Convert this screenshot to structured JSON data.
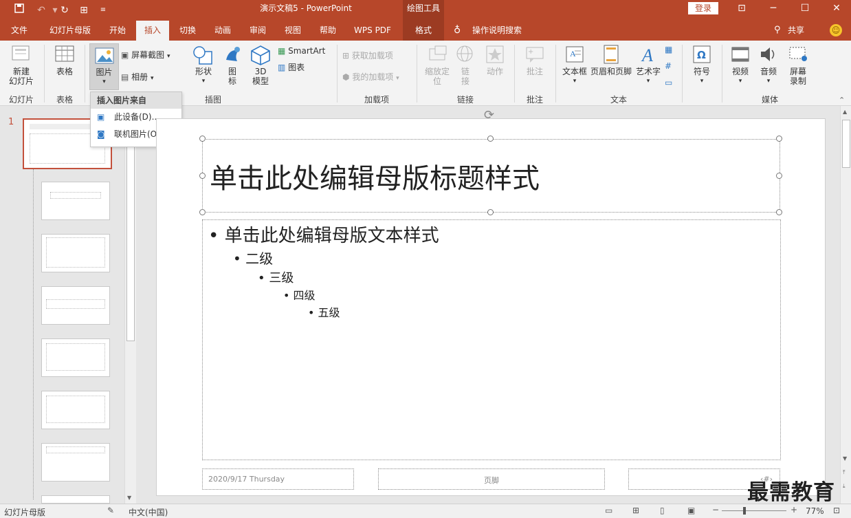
{
  "titlebar": {
    "document_title": "演示文稿5  -  PowerPoint",
    "context_tool": "绘图工具",
    "login": "登录"
  },
  "tabs": [
    "文件",
    "幻灯片母版",
    "开始",
    "插入",
    "切换",
    "动画",
    "审阅",
    "视图",
    "帮助",
    "WPS PDF"
  ],
  "active_tab": "插入",
  "context_tab": "格式",
  "tell_me": "操作说明搜索",
  "share": "共享",
  "ribbon": {
    "new_slide": "新建\n幻灯片",
    "group_slides": "幻灯片",
    "table": "表格",
    "group_table": "表格",
    "pictures": "图片",
    "screenshot": "屏幕截图",
    "album": "相册",
    "shapes": "形状",
    "icons": "图\n标",
    "model3d": "3D\n模型",
    "smartart": "SmartArt",
    "chart": "图表",
    "group_illustrations": "插图",
    "get_addins": "获取加载项",
    "my_addins": "我的加载项",
    "group_addins": "加载项",
    "zoom": "缩放定\n位",
    "link": "链\n接",
    "action": "动作",
    "group_links": "链接",
    "comment": "批注",
    "group_comments": "批注",
    "textbox": "文本框",
    "header_footer": "页眉和页脚",
    "wordart": "艺术字",
    "group_text": "文本",
    "symbol": "符号",
    "video": "视频",
    "audio": "音频",
    "screen_record": "屏幕\n录制",
    "group_media": "媒体"
  },
  "dropdown": {
    "header": "插入图片来自",
    "items": [
      "此设备(D)...",
      "联机图片(O)..."
    ]
  },
  "slide_number": "1",
  "slide": {
    "title": "单击此处编辑母版标题样式",
    "level1": "单击此处编辑母版文本样式",
    "level2": "二级",
    "level3": "三级",
    "level4": "四级",
    "level5": "五级",
    "date": "2020/9/17 Thursday",
    "footer": "页脚",
    "page_num": "‹#›"
  },
  "status": {
    "view": "幻灯片母版",
    "language": "中文(中国)",
    "zoom": "77%"
  },
  "watermark": "最需教育",
  "colors": {
    "accent": "#b7472a",
    "context": "#9c3b22",
    "ribbon_bg": "#f3f3f3"
  }
}
